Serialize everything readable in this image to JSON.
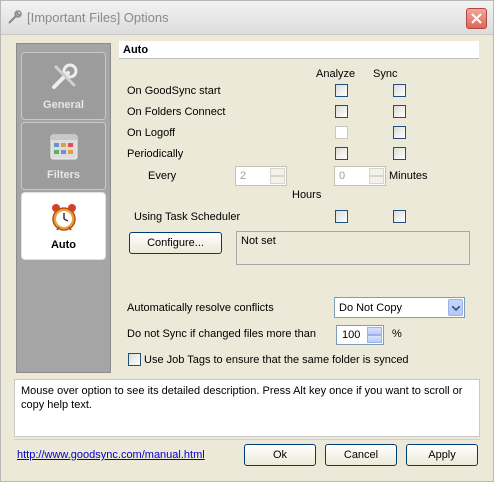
{
  "window": {
    "title": "[Important Files] Options"
  },
  "sidebar": {
    "items": [
      {
        "label": "General",
        "icon": "wrench-icon",
        "active": false
      },
      {
        "label": "Filters",
        "icon": "grid-icon",
        "active": false
      },
      {
        "label": "Auto",
        "icon": "alarm-clock-icon",
        "active": true
      }
    ]
  },
  "panel": {
    "title": "Auto",
    "col_analyze": "Analyze",
    "col_sync": "Sync",
    "rows": [
      {
        "label": "On GoodSync start"
      },
      {
        "label": "On Folders Connect"
      },
      {
        "label": "On Logoff"
      },
      {
        "label": "Periodically"
      }
    ],
    "every_label": "Every",
    "every_hours_value": "2",
    "every_minutes_value": "0",
    "hours_label": "Hours",
    "minutes_label": "Minutes",
    "scheduler_label": "Using Task Scheduler",
    "configure_label": "Configure...",
    "schedule_status": "Not set",
    "resolve_label": "Automatically resolve conflicts",
    "resolve_value": "Do Not Copy",
    "nosync_label": "Do not Sync if changed files more than",
    "nosync_value": "100",
    "nosync_unit": "%",
    "jobtags_label": "Use Job Tags to ensure that the same folder is synced"
  },
  "description": "Mouse over option to see its detailed description. Press Alt key once if you want to scroll or copy help text.",
  "footer": {
    "help_link": "http://www.goodsync.com/manual.html",
    "ok_label": "Ok",
    "cancel_label": "Cancel",
    "apply_label": "Apply"
  },
  "colors": {
    "close_red": "#d9695d",
    "sidebar_gray": "#a5a5a5",
    "button_border": "#003c74",
    "link_blue": "#0000cc"
  }
}
